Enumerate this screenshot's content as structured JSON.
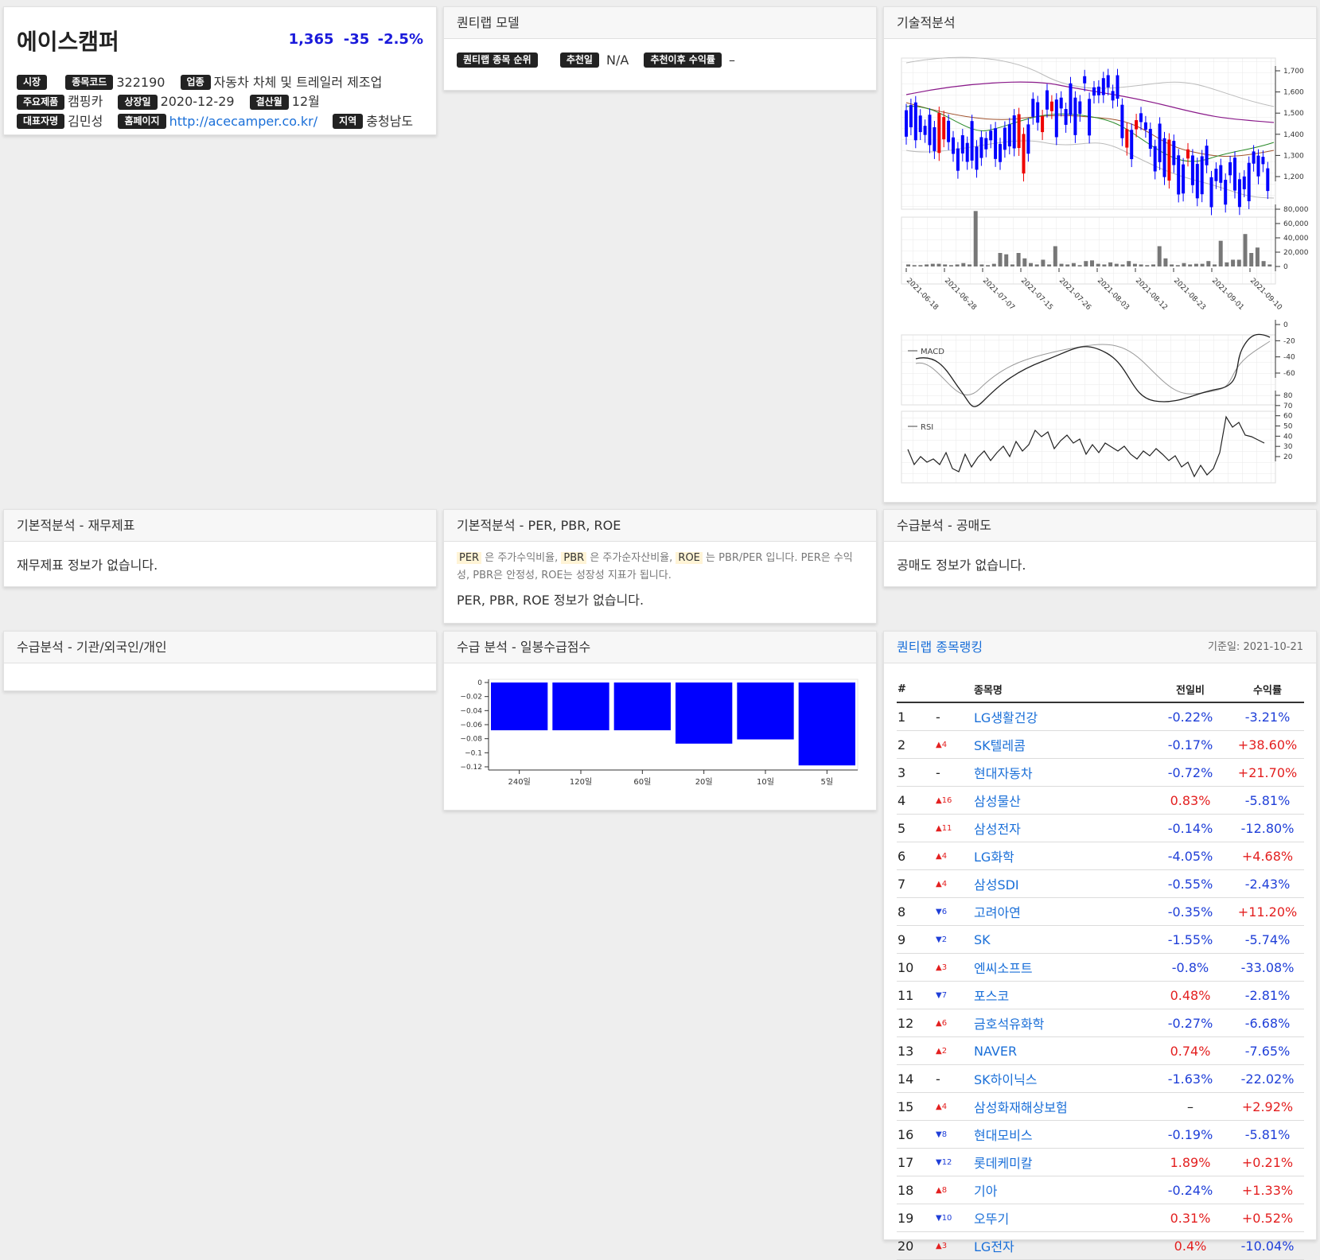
{
  "stock": {
    "name": "에이스캠퍼",
    "price": "1,365",
    "change": "-35",
    "change_pct": "-2.5%",
    "fields": {
      "market_label": "시장",
      "market_value": "",
      "code_label": "종목코드",
      "code_value": "322190",
      "industry_label": "업종",
      "industry_value": "자동차 차체 및 트레일러 제조업",
      "product_label": "주요제품",
      "product_value": "캠핑카",
      "listing_label": "상장일",
      "listing_value": "2020-12-29",
      "fiscal_label": "결산월",
      "fiscal_value": "12월",
      "ceo_label": "대표자명",
      "ceo_value": "김민성",
      "homepage_label": "홈페이지",
      "homepage_value": "http://acecamper.co.kr/",
      "region_label": "지역",
      "region_value": "충청남도"
    }
  },
  "quant_model": {
    "title": "퀀티랩 모델",
    "rank_label": "퀀티랩 종목 순위",
    "rec_date_label": "추천일",
    "rec_date_value": "N/A",
    "return_label": "추천이후 수익률",
    "return_value": "–"
  },
  "technical": {
    "title": "기술적분석",
    "price_axis": [
      "1,700",
      "1,600",
      "1,500",
      "1,400",
      "1,300",
      "1,200"
    ],
    "volume_axis": [
      "80,000",
      "60,000",
      "40,000",
      "20,000",
      "0"
    ],
    "dates": [
      "2021-06-18",
      "2021-06-28",
      "2021-07-07",
      "2021-07-15",
      "2021-07-26",
      "2021-08-03",
      "2021-08-12",
      "2021-08-23",
      "2021-09-01",
      "2021-09-10"
    ],
    "macd_label": "MACD",
    "macd_axis": [
      "0",
      "-20",
      "-40",
      "-60"
    ],
    "rsi_label": "RSI",
    "rsi_axis": [
      "80",
      "70",
      "60",
      "50",
      "40",
      "30",
      "20"
    ]
  },
  "financial": {
    "title": "기본적분석 - 재무제표",
    "message": "재무제표 정보가 없습니다."
  },
  "per": {
    "title": "기본적분석 - PER, PBR, ROE",
    "per_tag": "PER",
    "per_desc": "은 주가수익비율,",
    "pbr_tag": "PBR",
    "pbr_desc": "은 주가순자산비율,",
    "roe_tag": "ROE",
    "roe_desc": "는 PBR/PER 입니다. PER은 수익성, PBR은 안정성, ROE는 성장성 지표가 됩니다.",
    "message": "PER, PBR, ROE 정보가 없습니다."
  },
  "short": {
    "title": "수급분석 - 공매도",
    "message": "공매도 정보가 없습니다."
  },
  "investor": {
    "title": "수급분석 - 기관/외국인/개인"
  },
  "daily_score": {
    "title": "수급 분석 - 일봉수급점수",
    "y_ticks": [
      "0",
      "−0.02",
      "−0.04",
      "−0.06",
      "−0.08",
      "−0.1",
      "−0.12"
    ],
    "chart_data": {
      "type": "bar",
      "categories": [
        "240일",
        "120일",
        "60일",
        "20일",
        "10일",
        "5일"
      ],
      "values": [
        -0.068,
        -0.068,
        -0.068,
        -0.087,
        -0.081,
        -0.118
      ],
      "ylim": [
        -0.12,
        0
      ],
      "color": "#0000ff"
    }
  },
  "ranking": {
    "title": "퀀티랩 종목랭킹",
    "date": "기준일: 2021-10-21",
    "headers": [
      "#",
      "종목명",
      "전일비",
      "수익률"
    ],
    "rows": [
      {
        "n": "1",
        "mv": "-",
        "dir": "none",
        "name": "LG생활건강",
        "chg": "-0.22%",
        "ret": "-3.21%"
      },
      {
        "n": "2",
        "mv": "▲4",
        "dir": "up",
        "name": "SK텔레콤",
        "chg": "-0.17%",
        "ret": "+38.60%"
      },
      {
        "n": "3",
        "mv": "-",
        "dir": "none",
        "name": "현대자동차",
        "chg": "-0.72%",
        "ret": "+21.70%"
      },
      {
        "n": "4",
        "mv": "▲16",
        "dir": "up",
        "name": "삼성물산",
        "chg": "0.83%",
        "ret": "-5.81%"
      },
      {
        "n": "5",
        "mv": "▲11",
        "dir": "up",
        "name": "삼성전자",
        "chg": "-0.14%",
        "ret": "-12.80%"
      },
      {
        "n": "6",
        "mv": "▲4",
        "dir": "up",
        "name": "LG화학",
        "chg": "-4.05%",
        "ret": "+4.68%"
      },
      {
        "n": "7",
        "mv": "▲4",
        "dir": "up",
        "name": "삼성SDI",
        "chg": "-0.55%",
        "ret": "-2.43%"
      },
      {
        "n": "8",
        "mv": "▼6",
        "dir": "down",
        "name": "고려아연",
        "chg": "-0.35%",
        "ret": "+11.20%"
      },
      {
        "n": "9",
        "mv": "▼2",
        "dir": "down",
        "name": "SK",
        "chg": "-1.55%",
        "ret": "-5.74%"
      },
      {
        "n": "10",
        "mv": "▲3",
        "dir": "up",
        "name": "엔씨소프트",
        "chg": "-0.8%",
        "ret": "-33.08%"
      },
      {
        "n": "11",
        "mv": "▼7",
        "dir": "down",
        "name": "포스코",
        "chg": "0.48%",
        "ret": "-2.81%"
      },
      {
        "n": "12",
        "mv": "▲6",
        "dir": "up",
        "name": "금호석유화학",
        "chg": "-0.27%",
        "ret": "-6.68%"
      },
      {
        "n": "13",
        "mv": "▲2",
        "dir": "up",
        "name": "NAVER",
        "chg": "0.74%",
        "ret": "-7.65%"
      },
      {
        "n": "14",
        "mv": "-",
        "dir": "none",
        "name": "SK하이닉스",
        "chg": "-1.63%",
        "ret": "-22.02%"
      },
      {
        "n": "15",
        "mv": "▲4",
        "dir": "up",
        "name": "삼성화재해상보험",
        "chg": "–",
        "ret": "+2.92%"
      },
      {
        "n": "16",
        "mv": "▼8",
        "dir": "down",
        "name": "현대모비스",
        "chg": "-0.19%",
        "ret": "-5.81%"
      },
      {
        "n": "17",
        "mv": "▼12",
        "dir": "down",
        "name": "롯데케미칼",
        "chg": "1.89%",
        "ret": "+0.21%"
      },
      {
        "n": "18",
        "mv": "▲8",
        "dir": "up",
        "name": "기아",
        "chg": "-0.24%",
        "ret": "+1.33%"
      },
      {
        "n": "19",
        "mv": "▼10",
        "dir": "down",
        "name": "오뚜기",
        "chg": "0.31%",
        "ret": "+0.52%"
      },
      {
        "n": "20",
        "mv": "▲3",
        "dir": "up",
        "name": "LG전자",
        "chg": "0.4%",
        "ret": "-10.04%"
      }
    ]
  }
}
